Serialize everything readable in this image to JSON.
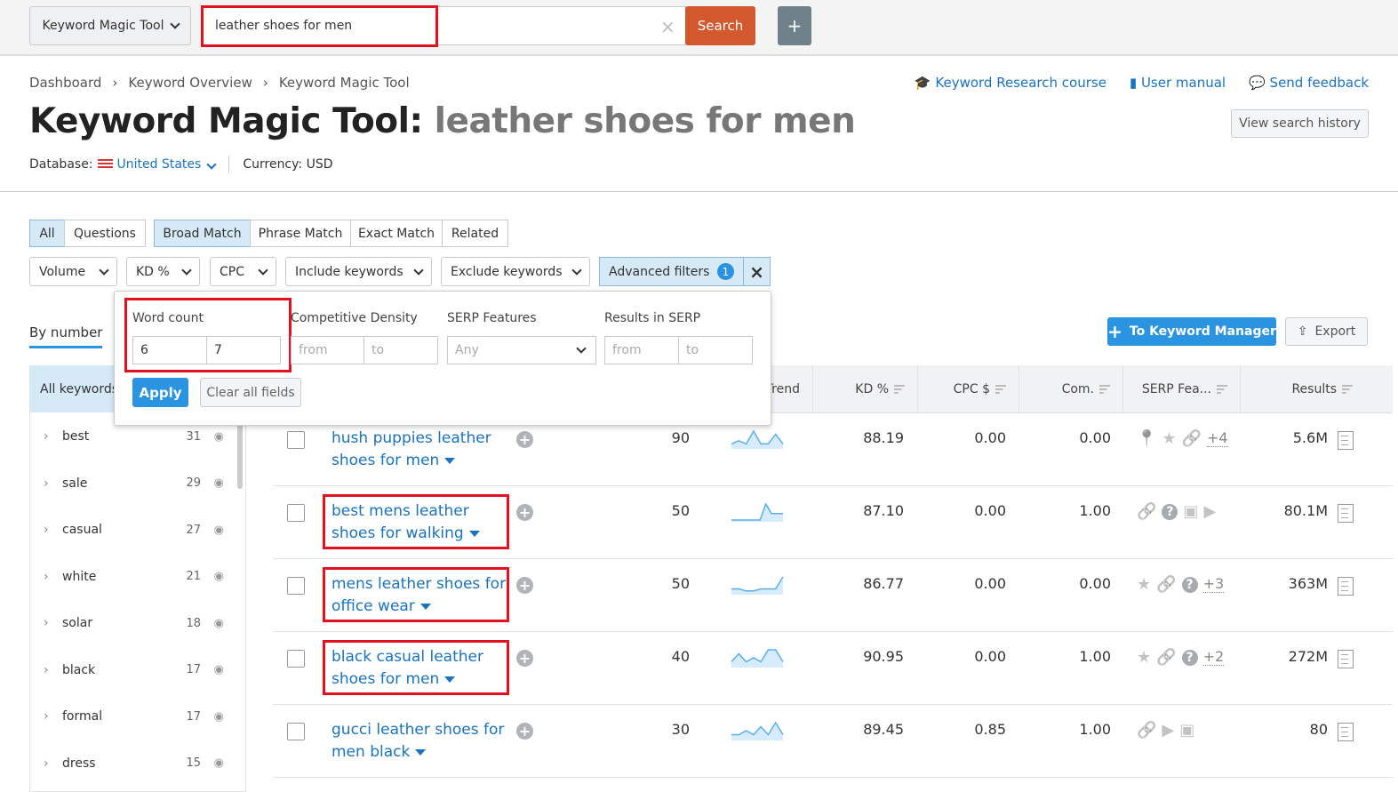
{
  "topbar": {
    "tool_select": "Keyword Magic Tool",
    "search_value": "leather shoes for men",
    "search_button": "Search",
    "add_button": "+",
    "clear": "×"
  },
  "breadcrumb": [
    "Dashboard",
    "Keyword Overview",
    "Keyword Magic Tool"
  ],
  "help_links": {
    "course": "Keyword Research course",
    "manual": "User manual",
    "feedback": "Send feedback"
  },
  "view_history": "View search history",
  "title": {
    "prefix": "Keyword Magic Tool:",
    "query": "leather shoes for men"
  },
  "database": {
    "label": "Database:",
    "value": "United States",
    "currency": "Currency: USD"
  },
  "tabs_type": [
    {
      "label": "All",
      "active": true
    },
    {
      "label": "Questions",
      "active": false
    }
  ],
  "tabs_match": [
    {
      "label": "Broad Match",
      "active": true
    },
    {
      "label": "Phrase Match",
      "active": false
    },
    {
      "label": "Exact Match",
      "active": false
    },
    {
      "label": "Related",
      "active": false
    }
  ],
  "filters": [
    "Volume",
    "KD %",
    "CPC",
    "Include keywords",
    "Exclude keywords"
  ],
  "advanced": {
    "label": "Advanced filters",
    "badge": "1"
  },
  "popup": {
    "word_count": {
      "label": "Word count",
      "from": "6",
      "to": "7"
    },
    "density": {
      "label": "Competitive Density",
      "from": "from",
      "to": "to"
    },
    "serp": {
      "label": "SERP Features",
      "value": "Any"
    },
    "results": {
      "label": "Results in SERP",
      "from": "from",
      "to": "to"
    },
    "apply": "Apply",
    "clear": "Clear all fields"
  },
  "sidebar": {
    "tab": "By number",
    "header": "All keywords",
    "items": [
      {
        "label": "best",
        "count": "31"
      },
      {
        "label": "sale",
        "count": "29"
      },
      {
        "label": "casual",
        "count": "27"
      },
      {
        "label": "white",
        "count": "21"
      },
      {
        "label": "solar",
        "count": "18"
      },
      {
        "label": "black",
        "count": "17"
      },
      {
        "label": "formal",
        "count": "17"
      },
      {
        "label": "dress",
        "count": "15"
      }
    ]
  },
  "actions": {
    "manager": "To Keyword Manager",
    "export": "Export"
  },
  "columns": {
    "trend": "Trend",
    "kd": "KD %",
    "cpc": "CPC $",
    "com": "Com.",
    "serp": "SERP Fea...",
    "results": "Results"
  },
  "rows": [
    {
      "keyword": "hush puppies leather shoes for men",
      "volume": "90",
      "kd": "88.19",
      "cpc": "0.00",
      "com": "0.00",
      "serp": [
        "pin",
        "star",
        "link"
      ],
      "more": "+4",
      "results": "5.6M",
      "trend": [
        1,
        2,
        1,
        5,
        1,
        1,
        4,
        1
      ]
    },
    {
      "keyword": "best mens leather shoes for walking",
      "volume": "50",
      "kd": "87.10",
      "cpc": "0.00",
      "com": "1.00",
      "serp": [
        "link",
        "question",
        "image",
        "video"
      ],
      "more": "",
      "results": "80.1M",
      "trend": [
        0,
        0,
        0,
        0,
        0,
        0,
        5,
        2,
        2,
        2
      ]
    },
    {
      "keyword": "mens leather shoes for office wear",
      "volume": "50",
      "kd": "86.77",
      "cpc": "0.00",
      "com": "0.00",
      "serp": [
        "star",
        "link",
        "question"
      ],
      "more": "+3",
      "results": "363M",
      "trend": [
        1,
        1,
        0.5,
        0.5,
        1,
        1,
        1,
        4
      ]
    },
    {
      "keyword": "black casual leather shoes for men",
      "volume": "40",
      "kd": "90.95",
      "cpc": "0.00",
      "com": "1.00",
      "serp": [
        "star",
        "link",
        "question"
      ],
      "more": "+2",
      "results": "272M",
      "trend": [
        1,
        3,
        1,
        2,
        1,
        4,
        4,
        1
      ]
    },
    {
      "keyword": "gucci leather shoes for men black",
      "volume": "30",
      "kd": "89.45",
      "cpc": "0.85",
      "com": "1.00",
      "serp": [
        "link",
        "video",
        "image"
      ],
      "more": "",
      "results": "80",
      "trend": [
        1,
        1,
        2,
        1,
        3,
        1,
        4,
        1
      ]
    }
  ],
  "colors": {
    "accent": "#1a73c0",
    "search": "#d4582d",
    "primary": "#2b94e1",
    "highlight": "#e3101f"
  }
}
